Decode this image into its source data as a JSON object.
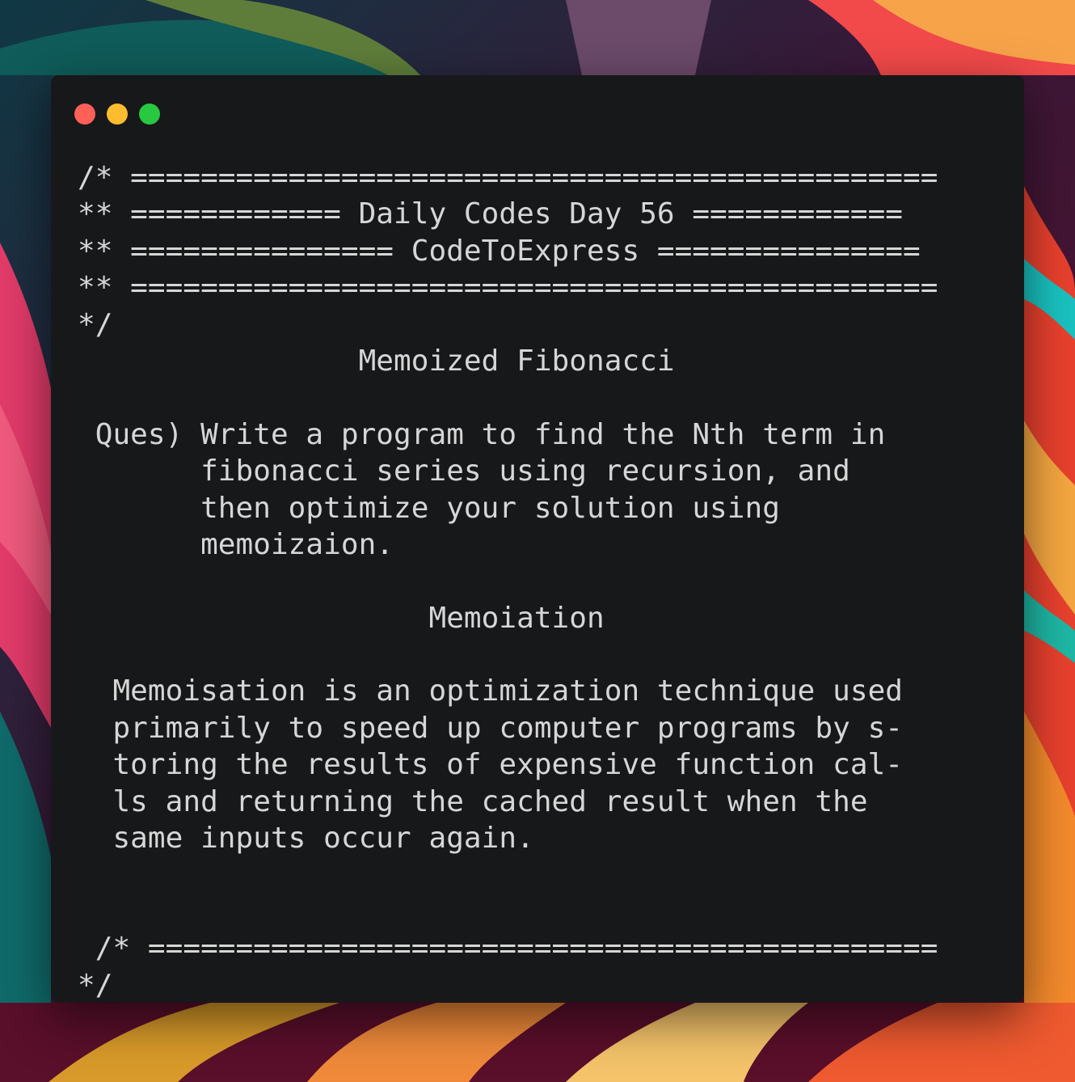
{
  "window": {
    "controls": [
      {
        "name": "close-button",
        "color": "#fe5f57"
      },
      {
        "name": "minimize-button",
        "color": "#febc2e"
      },
      {
        "name": "zoom-button",
        "color": "#28c840"
      }
    ]
  },
  "code_lines": [
    "/* ==============================================",
    "** ============ Daily Codes Day 56 ============",
    "** =============== CodeToExpress ===============",
    "** ==============================================",
    "*/",
    "                Memoized Fibonacci",
    "",
    " Ques) Write a program to find the Nth term in",
    "       fibonacci series using recursion, and",
    "       then optimize your solution using",
    "       memoizaion.",
    "",
    "                    Memoiation",
    "",
    "  Memoisation is an optimization technique used",
    "  primarily to speed up computer programs by s-",
    "  toring the results of expensive function cal-",
    "  ls and returning the cached result when the",
    "  same inputs occur again.",
    "",
    "",
    " /* =============================================",
    "*/"
  ],
  "colors": {
    "window_background": "#17181a",
    "code_text": "#d6d6d6"
  }
}
